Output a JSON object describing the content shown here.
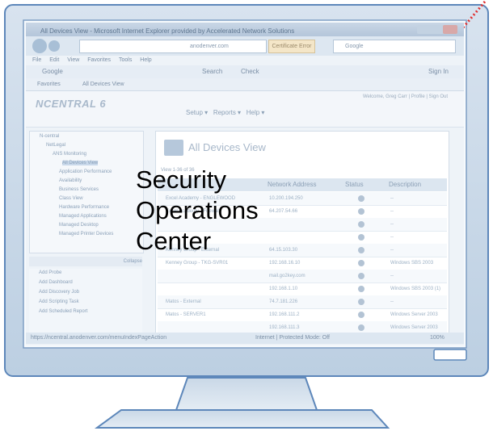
{
  "overlay": {
    "lines": [
      "Security",
      "Operations",
      "Center"
    ]
  },
  "browser": {
    "window_title": "All Devices View - Microsoft Internet Explorer provided by Accelerated Network Solutions",
    "address_text": "anodenver.com",
    "certificate_label": "Certificate Error",
    "search_placeholder": "Google",
    "menu": [
      "File",
      "Edit",
      "View",
      "Favorites",
      "Tools",
      "Help"
    ],
    "google_label": "Google",
    "search_button": "Search",
    "check_button": "Check",
    "signin": "Sign In",
    "favorites": "Favorites",
    "tab_label": "All Devices View",
    "status_url": "https://ncentral.anodenver.com/menuIndexPageAction",
    "status_zone": "Internet | Protected Mode: Off",
    "zoom": "100%"
  },
  "app": {
    "logo": "NCENTRAL 6",
    "welcome": "Welcome, Greg Carr | Profile | Sign Out",
    "nav": [
      "Setup",
      "Reports",
      "Help"
    ],
    "tree": [
      "N-central",
      "NetLegal",
      "ANS Monitoring",
      "All Devices View",
      "Application Performance",
      "Availability",
      "Business Services",
      "Class View",
      "Hardware Performance",
      "Managed Applications",
      "Managed Desktop",
      "Managed Printer Devices"
    ],
    "collapse_label": "Collapse",
    "actions": [
      "Add Probe",
      "Add Dashboard",
      "Add Discovery Job",
      "Add Scripting Task",
      "Add Scheduled Report"
    ],
    "view_title": "All Devices View",
    "view_range": "View 1-36 of 36",
    "columns": [
      "Network Address",
      "Status",
      "Description"
    ],
    "rows": [
      {
        "name": "Excel Academy - ENGLEWOOD",
        "address": "10.200.194.250",
        "description": "--"
      },
      {
        "name": "Excel Academy - Firewall",
        "address": "64.207.54.66",
        "description": "--"
      },
      {
        "name": "",
        "address": "",
        "description": "--"
      },
      {
        "name": "",
        "address": "",
        "description": "--"
      },
      {
        "name": "Kenney Group - External",
        "address": "64.15.103.30",
        "description": "--"
      },
      {
        "name": "Kenney Group - TKG-SVR01",
        "address": "192.168.16.10",
        "description": "Windows SBS 2003"
      },
      {
        "name": "",
        "address": "mail.go2key.com",
        "description": "--"
      },
      {
        "name": "",
        "address": "192.168.1.10",
        "description": "Windows SBS 2003 (1)"
      },
      {
        "name": "Matos - External",
        "address": "74.7.181.226",
        "description": "--"
      },
      {
        "name": "Matos - SERVER1",
        "address": "192.168.111.2",
        "description": "Windows Server 2003"
      },
      {
        "name": "",
        "address": "192.168.111.3",
        "description": "Windows Server 2003"
      }
    ]
  },
  "colors": {
    "monitor_body": "#c7d6e6",
    "monitor_edge": "#5a83b6",
    "stand": "#c7d6e6",
    "arrow": "#e03030"
  }
}
